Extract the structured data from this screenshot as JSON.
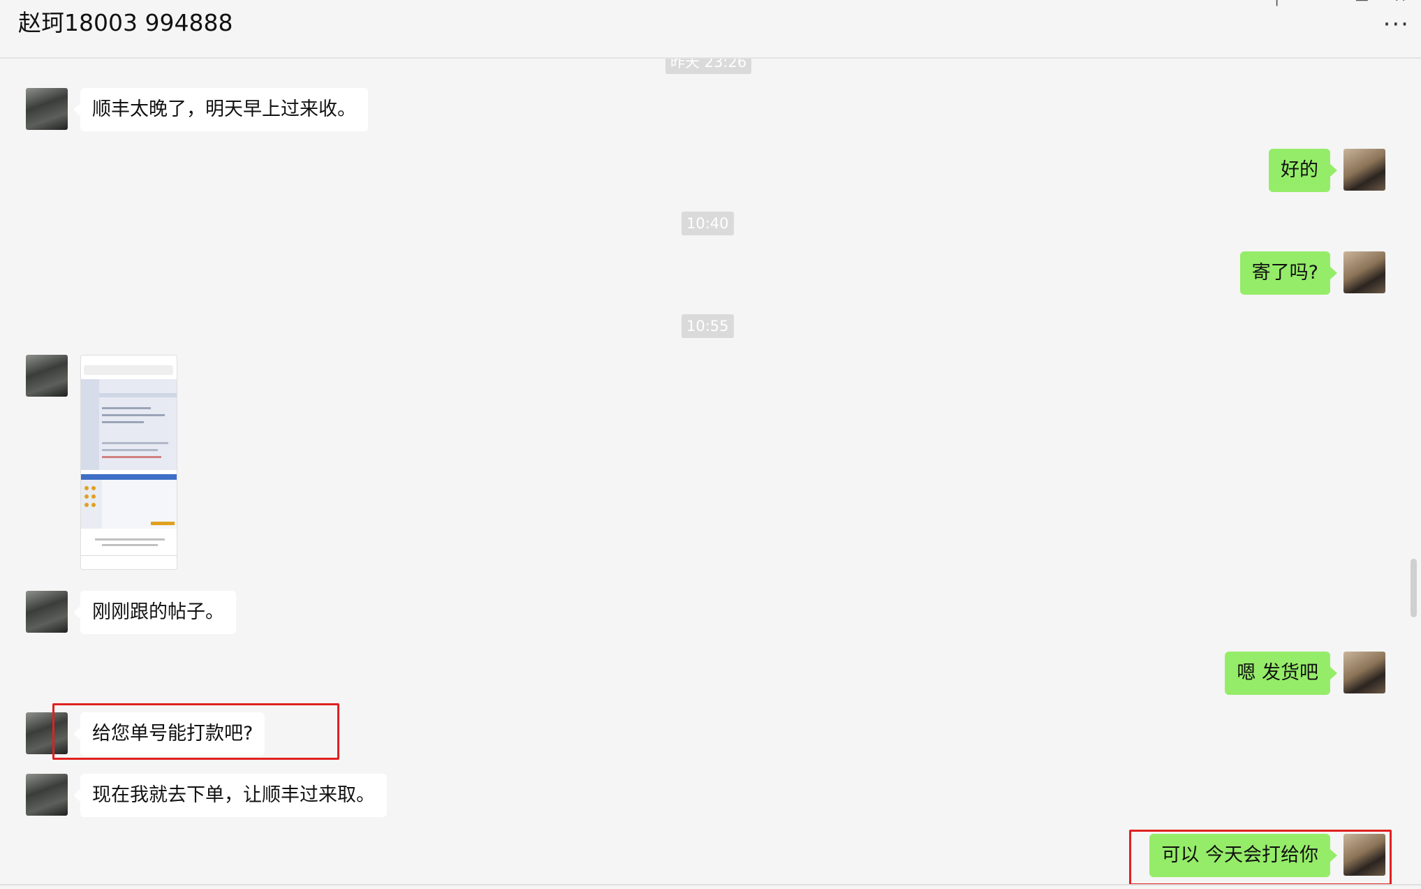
{
  "window": {
    "title": "赵珂18003 994888",
    "more_label": "···"
  },
  "timestamps": [
    "昨天 23:26",
    "10:40",
    "10:55"
  ],
  "messages": [
    {
      "side": "left",
      "text": "顺丰太晚了，明天早上过来收。"
    },
    {
      "side": "right",
      "text": "好的"
    },
    {
      "side": "right",
      "text": "寄了吗?"
    },
    {
      "side": "left",
      "type": "image",
      "text": ""
    },
    {
      "side": "left",
      "text": "刚刚跟的帖子。"
    },
    {
      "side": "right",
      "text": "嗯 发货吧"
    },
    {
      "side": "left",
      "text": "给您单号能打款吧?"
    },
    {
      "side": "left",
      "text": "现在我就去下单，让顺丰过来取。"
    },
    {
      "side": "right",
      "text": "可以 今天会打给你"
    }
  ],
  "colors": {
    "background": "#f5f5f5",
    "bubble_sent": "#95ec69",
    "bubble_received": "#ffffff",
    "highlight": "#e02020"
  }
}
